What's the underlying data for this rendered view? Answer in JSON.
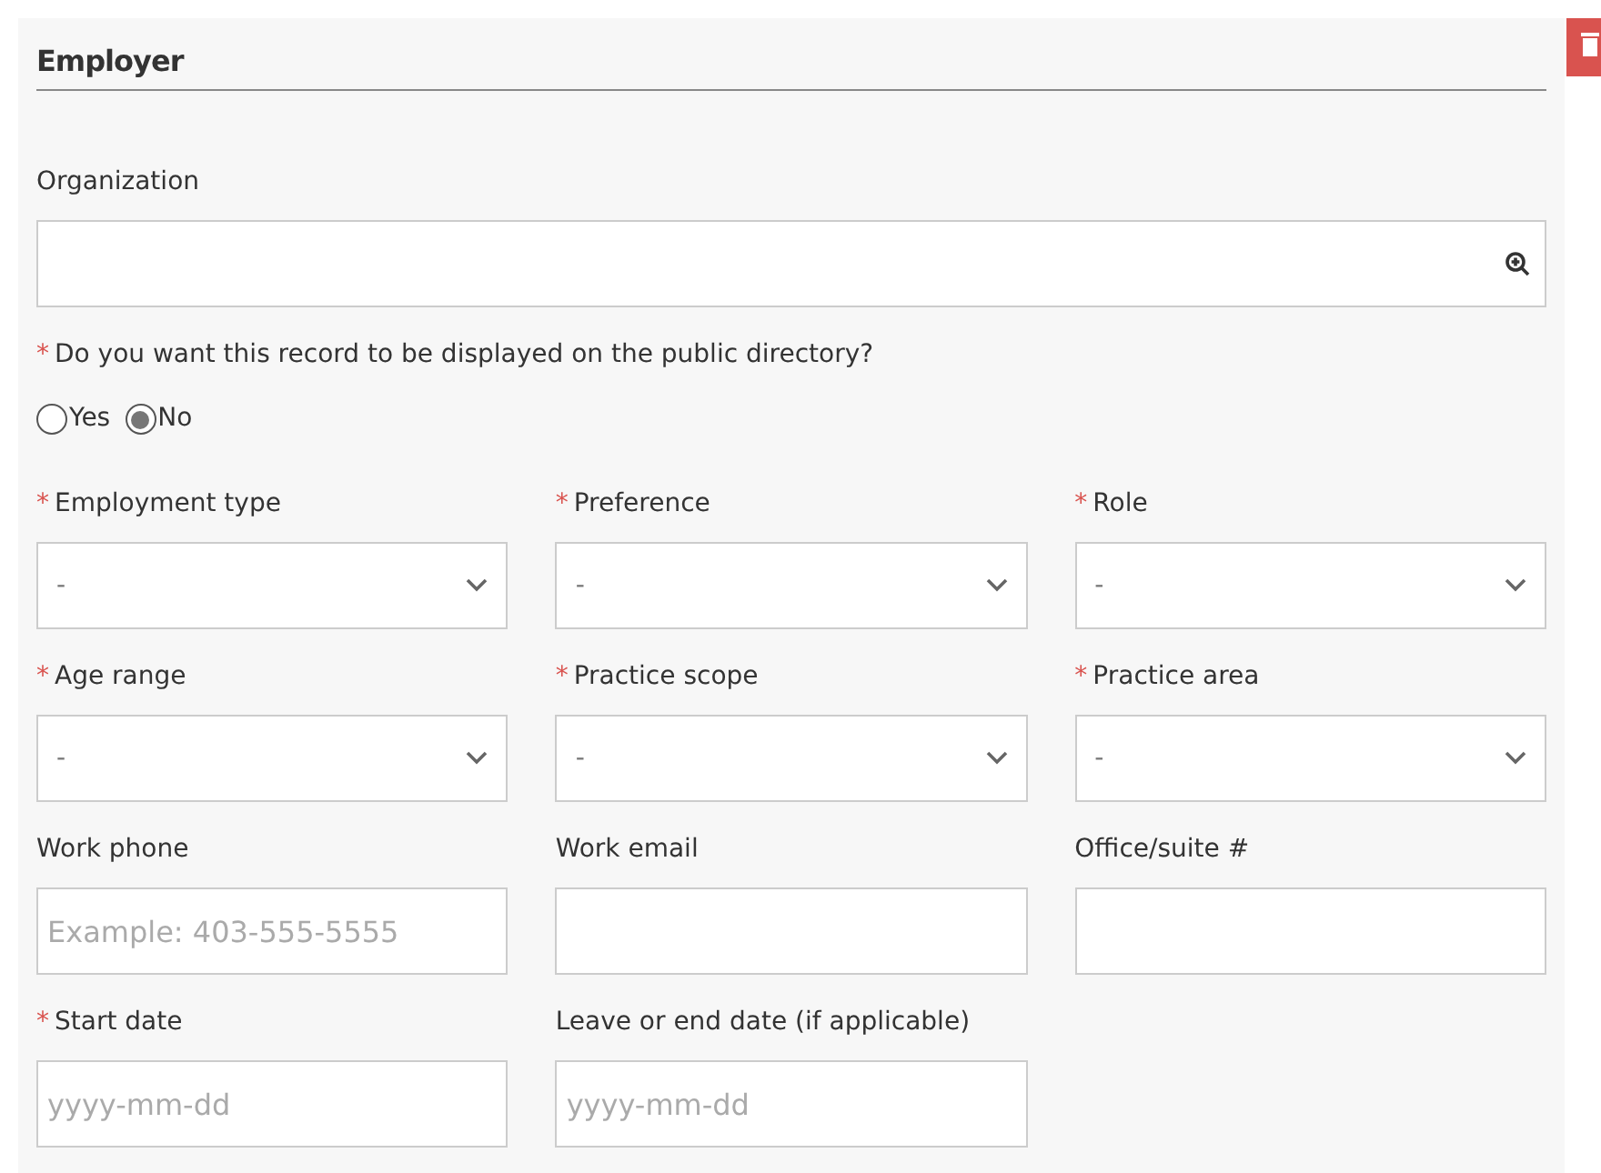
{
  "section": {
    "title": "Employer"
  },
  "organization": {
    "label": "Organization"
  },
  "question": {
    "required_mark": "*",
    "text": "Do you want this record to be displayed on the public directory?"
  },
  "options": [
    {
      "label": "Yes",
      "selected": false
    },
    {
      "label": "No",
      "selected": true
    }
  ],
  "fields": [
    {
      "kind": "select",
      "required_mark": "*",
      "label": "Employment type",
      "value": "-"
    },
    {
      "kind": "select",
      "required_mark": "*",
      "label": "Preference",
      "value": "-"
    },
    {
      "kind": "select",
      "required_mark": "*",
      "label": "Role",
      "value": "-"
    },
    {
      "kind": "select",
      "required_mark": "*",
      "label": "Age range",
      "value": "-"
    },
    {
      "kind": "select",
      "required_mark": "*",
      "label": "Practice scope",
      "value": "-"
    },
    {
      "kind": "select",
      "required_mark": "*",
      "label": "Practice area",
      "value": "-"
    },
    {
      "kind": "text",
      "label": "Work phone",
      "placeholder": "Example: 403-555-5555"
    },
    {
      "kind": "text",
      "label": "Work email"
    },
    {
      "kind": "text",
      "label": "Office/suite #"
    },
    {
      "kind": "text",
      "required_mark": "*",
      "label": "Start date",
      "placeholder": "yyyy-mm-dd"
    },
    {
      "kind": "text",
      "label": "Leave or end date (if applicable)",
      "placeholder": "yyyy-mm-dd"
    }
  ]
}
